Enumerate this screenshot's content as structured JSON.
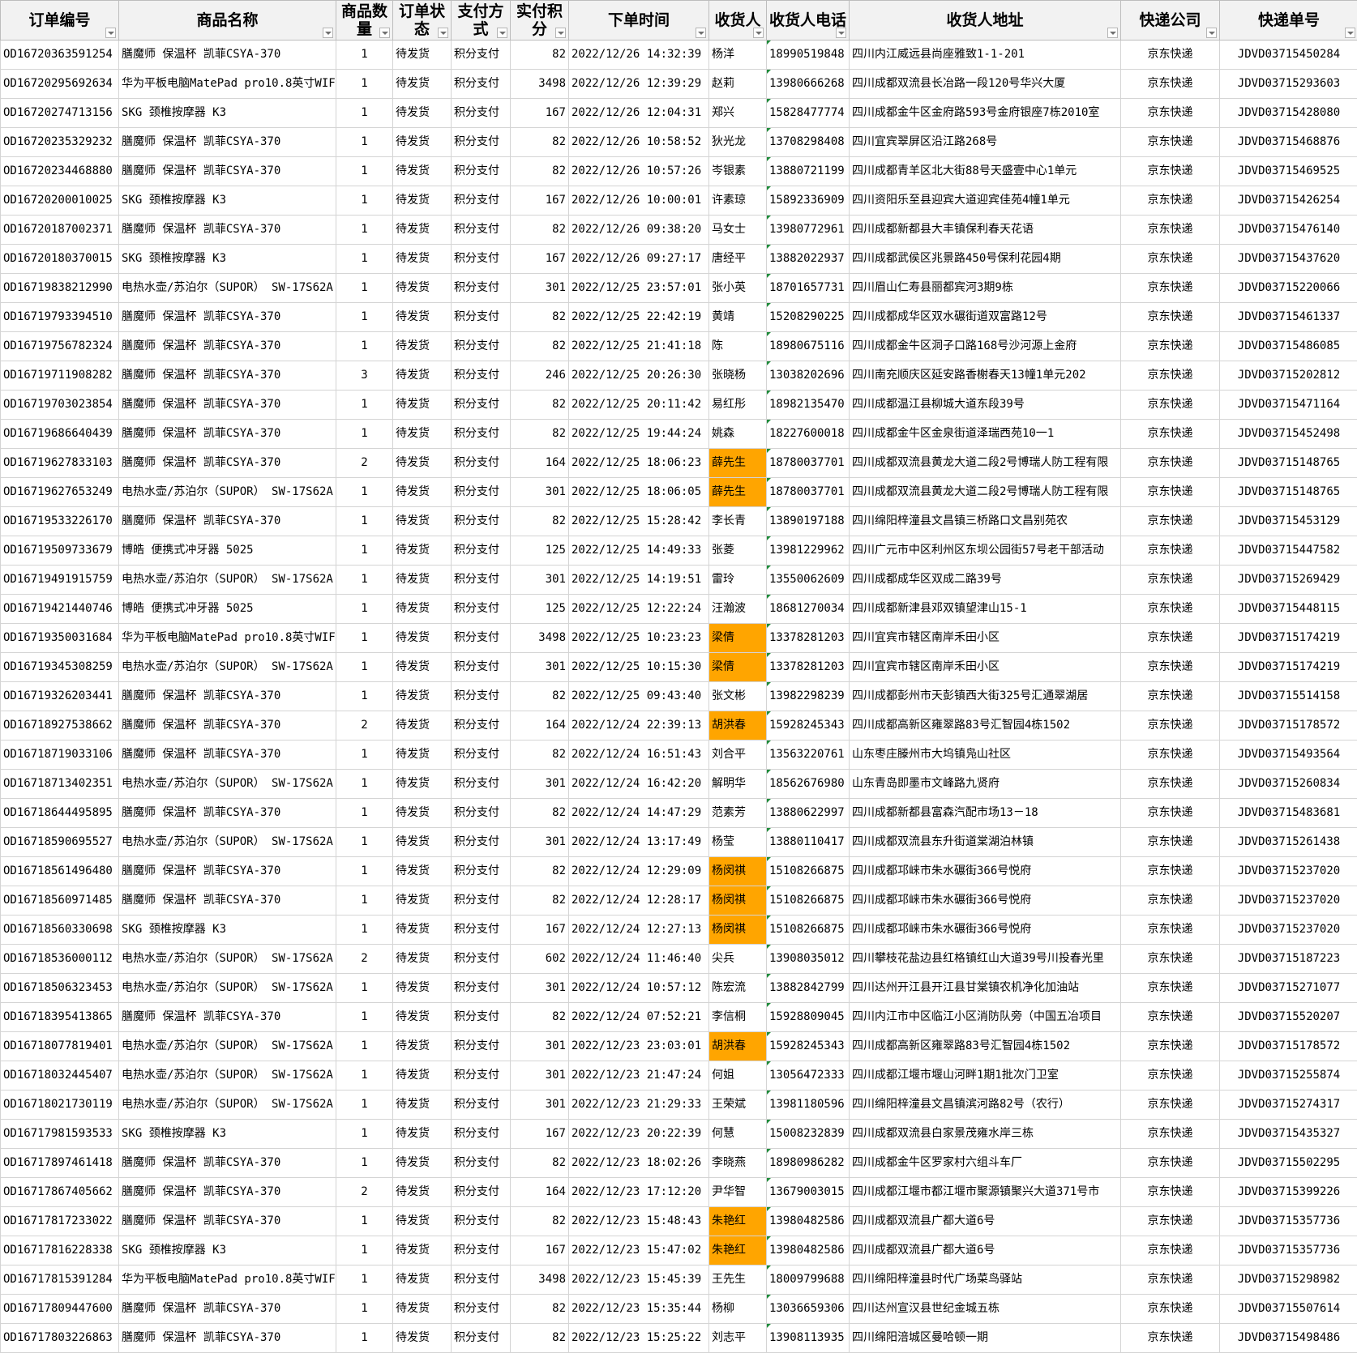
{
  "sheet": {
    "headers": [
      "订单编号",
      "商品名称",
      "商品数量",
      "订单状态",
      "支付方式",
      "实付积分",
      "下单时间",
      "收货人",
      "收货人电话",
      "收货人地址",
      "快递公司",
      "快递单号"
    ],
    "highlight_color": "#ffa500",
    "rows": [
      {
        "order_id": "OD16720363591254",
        "product": "膳魔师 保温杯 凯菲CSYA-370",
        "qty": "1",
        "status": "待发货",
        "pay": "积分支付",
        "points": "82",
        "time": "2022/12/26 14:32:39",
        "name": "杨洋",
        "highlight": false,
        "phone": "18990519848",
        "address": "四川内江威远县尚座雅致1-1-201",
        "courier": "京东快递",
        "tracking": "JDVD03715450284"
      },
      {
        "order_id": "OD16720295692634",
        "product": "华为平板电脑MatePad pro10.8英寸WIF",
        "qty": "1",
        "status": "待发货",
        "pay": "积分支付",
        "points": "3498",
        "time": "2022/12/26 12:39:29",
        "name": "赵莉",
        "highlight": false,
        "phone": "13980666268",
        "address": "四川成都双流县长冶路一段120号华兴大厦",
        "courier": "京东快递",
        "tracking": "JDVD03715293603"
      },
      {
        "order_id": "OD16720274713156",
        "product": "SKG 颈椎按摩器 K3",
        "qty": "1",
        "status": "待发货",
        "pay": "积分支付",
        "points": "167",
        "time": "2022/12/26 12:04:31",
        "name": "郑兴",
        "highlight": false,
        "phone": "15828477774",
        "address": "四川成都金牛区金府路593号金府银座7栋2010室",
        "courier": "京东快递",
        "tracking": "JDVD03715428080"
      },
      {
        "order_id": "OD16720235329232",
        "product": "膳魔师 保温杯 凯菲CSYA-370",
        "qty": "1",
        "status": "待发货",
        "pay": "积分支付",
        "points": "82",
        "time": "2022/12/26 10:58:52",
        "name": "狄光龙",
        "highlight": false,
        "phone": "13708298408",
        "address": "四川宜宾翠屏区沿江路268号",
        "courier": "京东快递",
        "tracking": "JDVD03715468876"
      },
      {
        "order_id": "OD16720234468880",
        "product": "膳魔师 保温杯 凯菲CSYA-370",
        "qty": "1",
        "status": "待发货",
        "pay": "积分支付",
        "points": "82",
        "time": "2022/12/26 10:57:26",
        "name": "岑银素",
        "highlight": false,
        "phone": "13880721199",
        "address": "四川成都青羊区北大街88号天盛壹中心1单元",
        "courier": "京东快递",
        "tracking": "JDVD03715469525"
      },
      {
        "order_id": "OD16720200010025",
        "product": "SKG 颈椎按摩器 K3",
        "qty": "1",
        "status": "待发货",
        "pay": "积分支付",
        "points": "167",
        "time": "2022/12/26 10:00:01",
        "name": "许素琼",
        "highlight": false,
        "phone": "15892336909",
        "address": "四川资阳乐至县迎宾大道迎宾佳苑4幢1单元",
        "courier": "京东快递",
        "tracking": "JDVD03715426254"
      },
      {
        "order_id": "OD16720187002371",
        "product": "膳魔师 保温杯 凯菲CSYA-370",
        "qty": "1",
        "status": "待发货",
        "pay": "积分支付",
        "points": "82",
        "time": "2022/12/26 09:38:20",
        "name": "马女士",
        "highlight": false,
        "phone": "13980772961",
        "address": "四川成都新都县大丰镇保利春天花语",
        "courier": "京东快递",
        "tracking": "JDVD03715476140"
      },
      {
        "order_id": "OD16720180370015",
        "product": "SKG 颈椎按摩器 K3",
        "qty": "1",
        "status": "待发货",
        "pay": "积分支付",
        "points": "167",
        "time": "2022/12/26 09:27:17",
        "name": "唐经平",
        "highlight": false,
        "phone": "13882022937",
        "address": "四川成都武侯区兆景路450号保利花园4期",
        "courier": "京东快递",
        "tracking": "JDVD03715437620"
      },
      {
        "order_id": "OD16719838212990",
        "product": "电热水壶/苏泊尔（SUPOR） SW-17S62A",
        "qty": "1",
        "status": "待发货",
        "pay": "积分支付",
        "points": "301",
        "time": "2022/12/25 23:57:01",
        "name": "张小英",
        "highlight": false,
        "phone": "18701657731",
        "address": "四川眉山仁寿县丽都宾河3期9栋",
        "courier": "京东快递",
        "tracking": "JDVD03715220066"
      },
      {
        "order_id": "OD16719793394510",
        "product": "膳魔师 保温杯 凯菲CSYA-370",
        "qty": "1",
        "status": "待发货",
        "pay": "积分支付",
        "points": "82",
        "time": "2022/12/25 22:42:19",
        "name": "黄靖",
        "highlight": false,
        "phone": "15208290225",
        "address": "四川成都成华区双水碾街道双富路12号",
        "courier": "京东快递",
        "tracking": "JDVD03715461337"
      },
      {
        "order_id": "OD16719756782324",
        "product": "膳魔师 保温杯 凯菲CSYA-370",
        "qty": "1",
        "status": "待发货",
        "pay": "积分支付",
        "points": "82",
        "time": "2022/12/25 21:41:18",
        "name": "陈",
        "highlight": false,
        "phone": "18980675116",
        "address": "四川成都金牛区洞子口路168号沙河源上金府",
        "courier": "京东快递",
        "tracking": "JDVD03715486085"
      },
      {
        "order_id": "OD16719711908282",
        "product": "膳魔师 保温杯 凯菲CSYA-370",
        "qty": "3",
        "status": "待发货",
        "pay": "积分支付",
        "points": "246",
        "time": "2022/12/25 20:26:30",
        "name": "张晓杨",
        "highlight": false,
        "phone": "13038202696",
        "address": "四川南充顺庆区延安路香榭春天13幢1单元202",
        "courier": "京东快递",
        "tracking": "JDVD03715202812"
      },
      {
        "order_id": "OD16719703023854",
        "product": "膳魔师 保温杯 凯菲CSYA-370",
        "qty": "1",
        "status": "待发货",
        "pay": "积分支付",
        "points": "82",
        "time": "2022/12/25 20:11:42",
        "name": "易红彤",
        "highlight": false,
        "phone": "18982135470",
        "address": "四川成都温江县柳城大道东段39号",
        "courier": "京东快递",
        "tracking": "JDVD03715471164"
      },
      {
        "order_id": "OD16719686640439",
        "product": "膳魔师 保温杯 凯菲CSYA-370",
        "qty": "1",
        "status": "待发货",
        "pay": "积分支付",
        "points": "82",
        "time": "2022/12/25 19:44:24",
        "name": "姚森",
        "highlight": false,
        "phone": "18227600018",
        "address": "四川成都金牛区金泉街道泽瑞西苑10一1",
        "courier": "京东快递",
        "tracking": "JDVD03715452498"
      },
      {
        "order_id": "OD16719627833103",
        "product": "膳魔师 保温杯 凯菲CSYA-370",
        "qty": "2",
        "status": "待发货",
        "pay": "积分支付",
        "points": "164",
        "time": "2022/12/25 18:06:23",
        "name": "薛先生",
        "highlight": true,
        "phone": "18780037701",
        "address": "四川成都双流县黄龙大道二段2号博瑞人防工程有限",
        "courier": "京东快递",
        "tracking": "JDVD03715148765"
      },
      {
        "order_id": "OD16719627653249",
        "product": "电热水壶/苏泊尔（SUPOR） SW-17S62A",
        "qty": "1",
        "status": "待发货",
        "pay": "积分支付",
        "points": "301",
        "time": "2022/12/25 18:06:05",
        "name": "薛先生",
        "highlight": true,
        "phone": "18780037701",
        "address": "四川成都双流县黄龙大道二段2号博瑞人防工程有限",
        "courier": "京东快递",
        "tracking": "JDVD03715148765"
      },
      {
        "order_id": "OD16719533226170",
        "product": "膳魔师 保温杯 凯菲CSYA-370",
        "qty": "1",
        "status": "待发货",
        "pay": "积分支付",
        "points": "82",
        "time": "2022/12/25 15:28:42",
        "name": "李长青",
        "highlight": false,
        "phone": "13890197188",
        "address": "四川绵阳梓潼县文昌镇三桥路口文昌别苑农",
        "courier": "京东快递",
        "tracking": "JDVD03715453129"
      },
      {
        "order_id": "OD16719509733679",
        "product": "博皓 便携式冲牙器 5025",
        "qty": "1",
        "status": "待发货",
        "pay": "积分支付",
        "points": "125",
        "time": "2022/12/25 14:49:33",
        "name": "张菱",
        "highlight": false,
        "phone": "13981229962",
        "address": "四川广元市中区利州区东坝公园街57号老干部活动",
        "courier": "京东快递",
        "tracking": "JDVD03715447582"
      },
      {
        "order_id": "OD16719491915759",
        "product": "电热水壶/苏泊尔（SUPOR） SW-17S62A",
        "qty": "1",
        "status": "待发货",
        "pay": "积分支付",
        "points": "301",
        "time": "2022/12/25 14:19:51",
        "name": "雷玲",
        "highlight": false,
        "phone": "13550062609",
        "address": "四川成都成华区双成二路39号",
        "courier": "京东快递",
        "tracking": "JDVD03715269429"
      },
      {
        "order_id": "OD16719421440746",
        "product": "博皓 便携式冲牙器 5025",
        "qty": "1",
        "status": "待发货",
        "pay": "积分支付",
        "points": "125",
        "time": "2022/12/25 12:22:24",
        "name": "汪瀚波",
        "highlight": false,
        "phone": "18681270034",
        "address": "四川成都新津县邓双镇望津山15-1",
        "courier": "京东快递",
        "tracking": "JDVD03715448115"
      },
      {
        "order_id": "OD16719350031684",
        "product": "华为平板电脑MatePad pro10.8英寸WIF",
        "qty": "1",
        "status": "待发货",
        "pay": "积分支付",
        "points": "3498",
        "time": "2022/12/25 10:23:23",
        "name": "梁倩",
        "highlight": true,
        "phone": "13378281203",
        "address": "四川宜宾市辖区南岸禾田小区",
        "courier": "京东快递",
        "tracking": "JDVD03715174219"
      },
      {
        "order_id": "OD16719345308259",
        "product": "电热水壶/苏泊尔（SUPOR） SW-17S62A",
        "qty": "1",
        "status": "待发货",
        "pay": "积分支付",
        "points": "301",
        "time": "2022/12/25 10:15:30",
        "name": "梁倩",
        "highlight": true,
        "phone": "13378281203",
        "address": "四川宜宾市辖区南岸禾田小区",
        "courier": "京东快递",
        "tracking": "JDVD03715174219"
      },
      {
        "order_id": "OD16719326203441",
        "product": "膳魔师 保温杯 凯菲CSYA-370",
        "qty": "1",
        "status": "待发货",
        "pay": "积分支付",
        "points": "82",
        "time": "2022/12/25 09:43:40",
        "name": "张文彬",
        "highlight": false,
        "phone": "13982298239",
        "address": "四川成都彭州市天彭镇西大街325号汇通翠湖居",
        "courier": "京东快递",
        "tracking": "JDVD03715514158"
      },
      {
        "order_id": "OD16718927538662",
        "product": "膳魔师 保温杯 凯菲CSYA-370",
        "qty": "2",
        "status": "待发货",
        "pay": "积分支付",
        "points": "164",
        "time": "2022/12/24 22:39:13",
        "name": "胡洪春",
        "highlight": true,
        "phone": "15928245343",
        "address": "四川成都高新区雍翠路83号汇智园4栋1502",
        "courier": "京东快递",
        "tracking": "JDVD03715178572"
      },
      {
        "order_id": "OD16718719033106",
        "product": "膳魔师 保温杯 凯菲CSYA-370",
        "qty": "1",
        "status": "待发货",
        "pay": "积分支付",
        "points": "82",
        "time": "2022/12/24 16:51:43",
        "name": "刘合平",
        "highlight": false,
        "phone": "13563220761",
        "address": "山东枣庄滕州市大坞镇凫山社区",
        "courier": "京东快递",
        "tracking": "JDVD03715493564"
      },
      {
        "order_id": "OD16718713402351",
        "product": "电热水壶/苏泊尔（SUPOR） SW-17S62A",
        "qty": "1",
        "status": "待发货",
        "pay": "积分支付",
        "points": "301",
        "time": "2022/12/24 16:42:20",
        "name": "解明华",
        "highlight": false,
        "phone": "18562676980",
        "address": "山东青岛即墨市文峰路九贤府",
        "courier": "京东快递",
        "tracking": "JDVD03715260834"
      },
      {
        "order_id": "OD16718644495895",
        "product": "膳魔师 保温杯 凯菲CSYA-370",
        "qty": "1",
        "status": "待发货",
        "pay": "积分支付",
        "points": "82",
        "time": "2022/12/24 14:47:29",
        "name": "范素芳",
        "highlight": false,
        "phone": "13880622997",
        "address": "四川成都新都县富森汽配市场13－18",
        "courier": "京东快递",
        "tracking": "JDVD03715483681"
      },
      {
        "order_id": "OD16718590695527",
        "product": "电热水壶/苏泊尔（SUPOR） SW-17S62A",
        "qty": "1",
        "status": "待发货",
        "pay": "积分支付",
        "points": "301",
        "time": "2022/12/24 13:17:49",
        "name": "杨莹",
        "highlight": false,
        "phone": "13880110417",
        "address": "四川成都双流县东升街道棠湖泊林镇",
        "courier": "京东快递",
        "tracking": "JDVD03715261438"
      },
      {
        "order_id": "OD16718561496480",
        "product": "膳魔师 保温杯 凯菲CSYA-370",
        "qty": "1",
        "status": "待发货",
        "pay": "积分支付",
        "points": "82",
        "time": "2022/12/24 12:29:09",
        "name": "杨闵祺",
        "highlight": true,
        "phone": "15108266875",
        "address": "四川成都邛崃市朱水碾街366号悦府",
        "courier": "京东快递",
        "tracking": "JDVD03715237020"
      },
      {
        "order_id": "OD16718560971485",
        "product": "膳魔师 保温杯 凯菲CSYA-370",
        "qty": "1",
        "status": "待发货",
        "pay": "积分支付",
        "points": "82",
        "time": "2022/12/24 12:28:17",
        "name": "杨闵祺",
        "highlight": true,
        "phone": "15108266875",
        "address": "四川成都邛崃市朱水碾街366号悦府",
        "courier": "京东快递",
        "tracking": "JDVD03715237020"
      },
      {
        "order_id": "OD16718560330698",
        "product": "SKG 颈椎按摩器 K3",
        "qty": "1",
        "status": "待发货",
        "pay": "积分支付",
        "points": "167",
        "time": "2022/12/24 12:27:13",
        "name": "杨闵祺",
        "highlight": true,
        "phone": "15108266875",
        "address": "四川成都邛崃市朱水碾街366号悦府",
        "courier": "京东快递",
        "tracking": "JDVD03715237020"
      },
      {
        "order_id": "OD16718536000112",
        "product": "电热水壶/苏泊尔（SUPOR） SW-17S62A",
        "qty": "2",
        "status": "待发货",
        "pay": "积分支付",
        "points": "602",
        "time": "2022/12/24 11:46:40",
        "name": "尖兵",
        "highlight": false,
        "phone": "13908035012",
        "address": "四川攀枝花盐边县红格镇红山大道39号川投春光里",
        "courier": "京东快递",
        "tracking": "JDVD03715187223"
      },
      {
        "order_id": "OD16718506323453",
        "product": "电热水壶/苏泊尔（SUPOR） SW-17S62A",
        "qty": "1",
        "status": "待发货",
        "pay": "积分支付",
        "points": "301",
        "time": "2022/12/24 10:57:12",
        "name": "陈宏流",
        "highlight": false,
        "phone": "13882842799",
        "address": "四川达州开江县开江县甘棠镇农机净化加油站",
        "courier": "京东快递",
        "tracking": "JDVD03715271077"
      },
      {
        "order_id": "OD16718395413865",
        "product": "膳魔师 保温杯 凯菲CSYA-370",
        "qty": "1",
        "status": "待发货",
        "pay": "积分支付",
        "points": "82",
        "time": "2022/12/24 07:52:21",
        "name": "李信桐",
        "highlight": false,
        "phone": "15928809045",
        "address": "四川内江市中区临江小区消防队旁（中国五冶项目",
        "courier": "京东快递",
        "tracking": "JDVD03715520207"
      },
      {
        "order_id": "OD16718077819401",
        "product": "电热水壶/苏泊尔（SUPOR） SW-17S62A",
        "qty": "1",
        "status": "待发货",
        "pay": "积分支付",
        "points": "301",
        "time": "2022/12/23 23:03:01",
        "name": "胡洪春",
        "highlight": true,
        "phone": "15928245343",
        "address": "四川成都高新区雍翠路83号汇智园4栋1502",
        "courier": "京东快递",
        "tracking": "JDVD03715178572"
      },
      {
        "order_id": "OD16718032445407",
        "product": "电热水壶/苏泊尔（SUPOR） SW-17S62A",
        "qty": "1",
        "status": "待发货",
        "pay": "积分支付",
        "points": "301",
        "time": "2022/12/23 21:47:24",
        "name": "何姐",
        "highlight": false,
        "phone": "13056472333",
        "address": "四川成都江堰市堰山河畔1期1批次门卫室",
        "courier": "京东快递",
        "tracking": "JDVD03715255874"
      },
      {
        "order_id": "OD16718021730119",
        "product": "电热水壶/苏泊尔（SUPOR） SW-17S62A",
        "qty": "1",
        "status": "待发货",
        "pay": "积分支付",
        "points": "301",
        "time": "2022/12/23 21:29:33",
        "name": "王荣斌",
        "highlight": false,
        "phone": "13981180596",
        "address": "四川绵阳梓潼县文昌镇滨河路82号（农行）",
        "courier": "京东快递",
        "tracking": "JDVD03715274317"
      },
      {
        "order_id": "OD16717981593533",
        "product": "SKG 颈椎按摩器 K3",
        "qty": "1",
        "status": "待发货",
        "pay": "积分支付",
        "points": "167",
        "time": "2022/12/23 20:22:39",
        "name": "何慧",
        "highlight": false,
        "phone": "15008232839",
        "address": "四川成都双流县白家景茂雍水岸三栋",
        "courier": "京东快递",
        "tracking": "JDVD03715435327"
      },
      {
        "order_id": "OD16717897461418",
        "product": "膳魔师 保温杯 凯菲CSYA-370",
        "qty": "1",
        "status": "待发货",
        "pay": "积分支付",
        "points": "82",
        "time": "2022/12/23 18:02:26",
        "name": "李晓燕",
        "highlight": false,
        "phone": "18980986282",
        "address": "四川成都金牛区罗家村六组斗车厂",
        "courier": "京东快递",
        "tracking": "JDVD03715502295"
      },
      {
        "order_id": "OD16717867405662",
        "product": "膳魔师 保温杯 凯菲CSYA-370",
        "qty": "2",
        "status": "待发货",
        "pay": "积分支付",
        "points": "164",
        "time": "2022/12/23 17:12:20",
        "name": "尹华智",
        "highlight": false,
        "phone": "13679003015",
        "address": "四川成都江堰市都江堰市聚源镇聚兴大道371号市",
        "courier": "京东快递",
        "tracking": "JDVD03715399226"
      },
      {
        "order_id": "OD16717817233022",
        "product": "膳魔师 保温杯 凯菲CSYA-370",
        "qty": "1",
        "status": "待发货",
        "pay": "积分支付",
        "points": "82",
        "time": "2022/12/23 15:48:43",
        "name": "朱艳红",
        "highlight": true,
        "phone": "13980482586",
        "address": "四川成都双流县广都大道6号",
        "courier": "京东快递",
        "tracking": "JDVD03715357736"
      },
      {
        "order_id": "OD16717816228338",
        "product": "SKG 颈椎按摩器 K3",
        "qty": "1",
        "status": "待发货",
        "pay": "积分支付",
        "points": "167",
        "time": "2022/12/23 15:47:02",
        "name": "朱艳红",
        "highlight": true,
        "phone": "13980482586",
        "address": "四川成都双流县广都大道6号",
        "courier": "京东快递",
        "tracking": "JDVD03715357736"
      },
      {
        "order_id": "OD16717815391284",
        "product": "华为平板电脑MatePad pro10.8英寸WIF",
        "qty": "1",
        "status": "待发货",
        "pay": "积分支付",
        "points": "3498",
        "time": "2022/12/23 15:45:39",
        "name": "王先生",
        "highlight": false,
        "phone": "18009799688",
        "address": "四川绵阳梓潼县时代广场菜鸟驿站",
        "courier": "京东快递",
        "tracking": "JDVD03715298982"
      },
      {
        "order_id": "OD16717809447600",
        "product": "膳魔师 保温杯 凯菲CSYA-370",
        "qty": "1",
        "status": "待发货",
        "pay": "积分支付",
        "points": "82",
        "time": "2022/12/23 15:35:44",
        "name": "杨柳",
        "highlight": false,
        "phone": "13036659306",
        "address": "四川达州宣汉县世纪金城五栋",
        "courier": "京东快递",
        "tracking": "JDVD03715507614"
      },
      {
        "order_id": "OD16717803226863",
        "product": "膳魔师 保温杯 凯菲CSYA-370",
        "qty": "1",
        "status": "待发货",
        "pay": "积分支付",
        "points": "82",
        "time": "2022/12/23 15:25:22",
        "name": "刘志平",
        "highlight": false,
        "phone": "13908113935",
        "address": "四川绵阳涪城区曼哈顿一期",
        "courier": "京东快递",
        "tracking": "JDVD03715498486"
      }
    ]
  }
}
